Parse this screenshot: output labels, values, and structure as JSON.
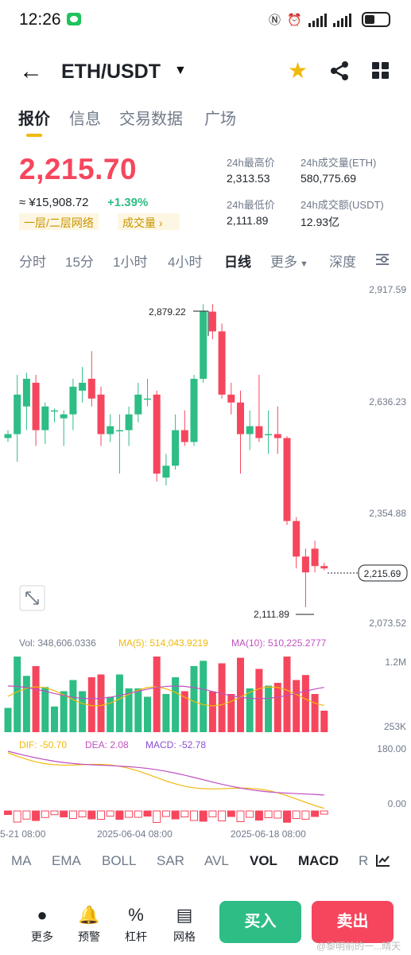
{
  "status_bar": {
    "time": "12:26"
  },
  "header": {
    "pair": "ETH/USDT"
  },
  "tabs": [
    "报价",
    "信息",
    "交易数据",
    "广场"
  ],
  "price": {
    "last": "2,215.70",
    "cny": "≈ ¥15,908.72",
    "change": "+1.39%",
    "tags": [
      "一层/二层网络",
      "成交量"
    ]
  },
  "stats": {
    "high_label": "24h最高价",
    "high": "2,313.53",
    "low_label": "24h最低价",
    "low": "2,111.89",
    "vol_eth_label": "24h成交量(ETH)",
    "vol_eth": "580,775.69",
    "vol_usdt_label": "24h成交额(USDT)",
    "vol_usdt": "12.93亿"
  },
  "intervals": [
    "分时",
    "15分",
    "1小时",
    "4小时",
    "日线",
    "更多",
    "深度"
  ],
  "chart_data": {
    "type": "candlestick",
    "y_axis_ticks": [
      "2,917.59",
      "2,636.23",
      "2,354.88",
      "2,073.52"
    ],
    "max_label": "2,879.22",
    "min_label": "2,111.89",
    "current_price_label": "2,215.69",
    "candles": [
      {
        "o": 2540,
        "c": 2550,
        "h": 2560,
        "l": 2530
      },
      {
        "o": 2550,
        "c": 2650,
        "h": 2700,
        "l": 2480
      },
      {
        "o": 2620,
        "c": 2690,
        "h": 2705,
        "l": 2560
      },
      {
        "o": 2680,
        "c": 2560,
        "h": 2700,
        "l": 2520
      },
      {
        "o": 2560,
        "c": 2620,
        "h": 2630,
        "l": 2525
      },
      {
        "o": 2610,
        "c": 2610,
        "h": 2615,
        "l": 2580
      },
      {
        "o": 2590,
        "c": 2600,
        "h": 2610,
        "l": 2520
      },
      {
        "o": 2600,
        "c": 2670,
        "h": 2690,
        "l": 2560
      },
      {
        "o": 2660,
        "c": 2680,
        "h": 2720,
        "l": 2630
      },
      {
        "o": 2690,
        "c": 2640,
        "h": 2760,
        "l": 2620
      },
      {
        "o": 2650,
        "c": 2550,
        "h": 2670,
        "l": 2520
      },
      {
        "o": 2550,
        "c": 2570,
        "h": 2600,
        "l": 2530
      },
      {
        "o": 2560,
        "c": 2560,
        "h": 2600,
        "l": 2450
      },
      {
        "o": 2560,
        "c": 2600,
        "h": 2620,
        "l": 2520
      },
      {
        "o": 2600,
        "c": 2650,
        "h": 2680,
        "l": 2580
      },
      {
        "o": 2640,
        "c": 2640,
        "h": 2690,
        "l": 2620
      },
      {
        "o": 2650,
        "c": 2450,
        "h": 2660,
        "l": 2430
      },
      {
        "o": 2440,
        "c": 2470,
        "h": 2500,
        "l": 2420
      },
      {
        "o": 2470,
        "c": 2560,
        "h": 2600,
        "l": 2460
      },
      {
        "o": 2560,
        "c": 2530,
        "h": 2610,
        "l": 2520
      },
      {
        "o": 2530,
        "c": 2690,
        "h": 2700,
        "l": 2520
      },
      {
        "o": 2690,
        "c": 2860,
        "h": 2879,
        "l": 2680
      },
      {
        "o": 2860,
        "c": 2810,
        "h": 2879,
        "l": 2790
      },
      {
        "o": 2810,
        "c": 2650,
        "h": 2830,
        "l": 2640
      },
      {
        "o": 2650,
        "c": 2630,
        "h": 2680,
        "l": 2600
      },
      {
        "o": 2630,
        "c": 2550,
        "h": 2660,
        "l": 2450
      },
      {
        "o": 2550,
        "c": 2570,
        "h": 2610,
        "l": 2510
      },
      {
        "o": 2570,
        "c": 2540,
        "h": 2700,
        "l": 2530
      },
      {
        "o": 2550,
        "c": 2550,
        "h": 2610,
        "l": 2500
      },
      {
        "o": 2550,
        "c": 2540,
        "h": 2620,
        "l": 2500
      },
      {
        "o": 2540,
        "c": 2330,
        "h": 2545,
        "l": 2320
      },
      {
        "o": 2330,
        "c": 2240,
        "h": 2340,
        "l": 2210
      },
      {
        "o": 2240,
        "c": 2200,
        "h": 2260,
        "l": 2112
      },
      {
        "o": 2260,
        "c": 2216,
        "h": 2280,
        "l": 2200
      },
      {
        "o": 2216,
        "c": 2210,
        "h": 2225,
        "l": 2205
      }
    ],
    "volume": {
      "label": "Vol: 348,606.0336",
      "ma5_label": "MA(5): 514,043.9219",
      "ma10_label": "MA(10): 510,225.2777",
      "axis_ticks": [
        "1.2M",
        "253K"
      ]
    },
    "macd": {
      "dif_label": "DIF: -50.70",
      "dea_label": "DEA: 2.08",
      "macd_label": "MACD: -52.78",
      "axis_ticks": [
        "180.00",
        "0.00"
      ]
    },
    "x_labels": [
      "5-21 08:00",
      "2025-06-04 08:00",
      "2025-06-18 08:00"
    ]
  },
  "indicators": [
    "MA",
    "EMA",
    "BOLL",
    "SAR",
    "AVL",
    "VOL",
    "MACD",
    "R"
  ],
  "bottom_bar": {
    "items": [
      "更多",
      "预警",
      "杠杆",
      "网格"
    ],
    "buy": "买入",
    "sell": "卖出"
  },
  "watermark": "@黎明前的一...晴天"
}
